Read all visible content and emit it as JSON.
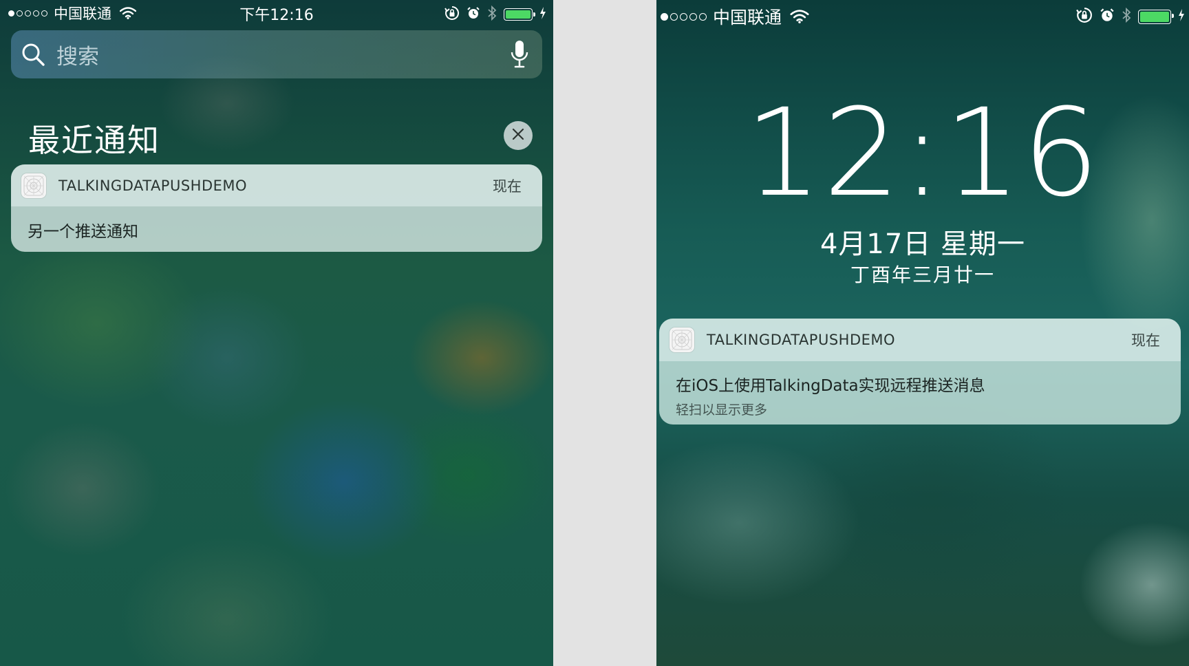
{
  "left_screen": {
    "status_bar": {
      "signal_dots": [
        true,
        false,
        false,
        false,
        false
      ],
      "carrier": "中国联通",
      "time": "下午12:16",
      "battery_level": 1.0
    },
    "search": {
      "placeholder": "搜索"
    },
    "recent_notifications": {
      "title": "最近通知",
      "clear_icon": "close-icon"
    },
    "notification": {
      "app_name": "TALKINGDATAPUSHDEMO",
      "time": "现在",
      "body": "另一个推送通知"
    }
  },
  "right_screen": {
    "status_bar": {
      "signal_dots": [
        true,
        false,
        false,
        false,
        false
      ],
      "carrier": "中国联通",
      "battery_level": 1.0
    },
    "lock_screen": {
      "clock": "12:16",
      "date": "4月17日 星期一",
      "lunar_date": "丁酉年三月廿一"
    },
    "notification": {
      "app_name": "TALKINGDATAPUSHDEMO",
      "time": "现在",
      "body": "在iOS上使用TalkingData实现远程推送消息",
      "hint": "轻扫以显示更多"
    }
  },
  "colors": {
    "battery_fill": "#4cd964",
    "divider_background": "#e3e3e3"
  }
}
